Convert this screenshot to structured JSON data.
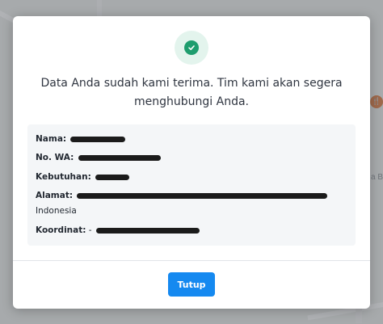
{
  "modal": {
    "message": "Data Anda sudah kami terima. Tim kami akan segera menghubungi Anda.",
    "fields": {
      "nama_label": "Nama:",
      "wa_label": "No. WA:",
      "kebutuhan_label": "Kebutuhan:",
      "alamat_label": "Alamat:",
      "alamat_suffix": "Indonesia",
      "koordinat_label": "Koordinat:",
      "koordinat_prefix": "-"
    },
    "close_button": "Tutup"
  },
  "background": {
    "map_fragment_right": "a B"
  },
  "colors": {
    "success": "#1e9d6e",
    "primary": "#1589f0"
  },
  "icons": {
    "status": "check-circle-icon",
    "map_pin": "restaurant-icon"
  }
}
